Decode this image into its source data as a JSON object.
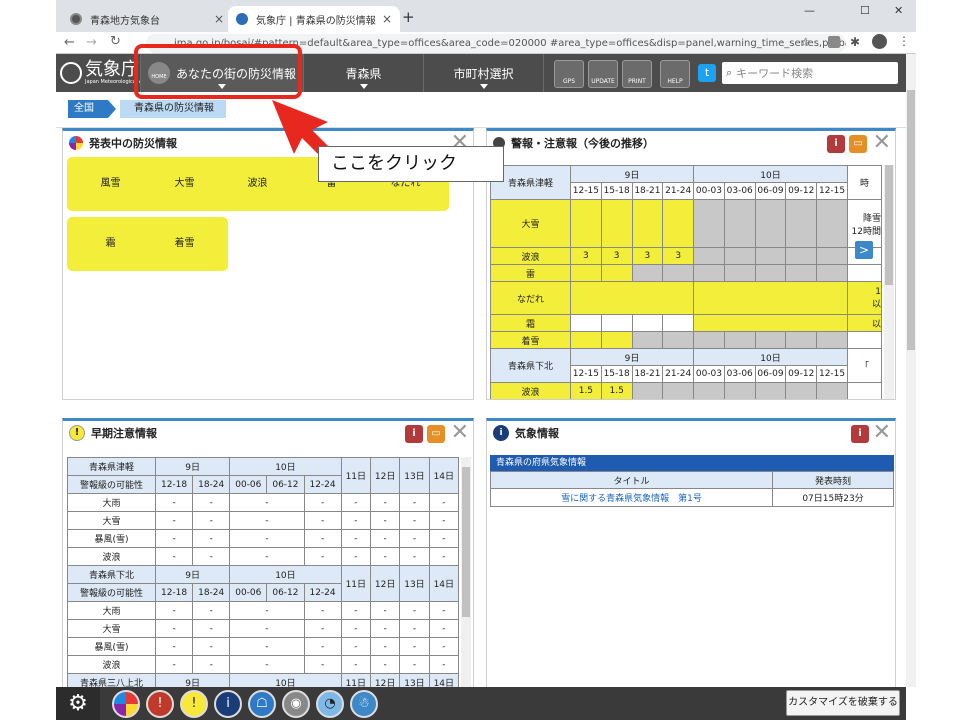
{
  "browser": {
    "tabs": [
      {
        "title": "青森地方気象台",
        "close": "×"
      },
      {
        "title": "気象庁 | 青森県の防災情報",
        "close": "×"
      }
    ],
    "new_tab": "+",
    "window_controls": {
      "minimize": "—",
      "maximize": "☐",
      "close": "✕"
    },
    "url": "jma.go.jp/bosai/#pattern=default&area_type=offices&area_code=020000  #area_type=offices&disp=panel,warning_time_series,probability,information,forecaster_comment,radar,amedas!temp,snow&area_type=offices&a..."
  },
  "site": {
    "logo_main": "気象庁",
    "logo_sub": "Japan Meteorological Agency",
    "nav": {
      "home_label": "HOME",
      "bosai": "あなたの街の防災情報",
      "pref": "青森県",
      "city": "市町村選択"
    },
    "icons": {
      "gps": "GPS",
      "update": "UPDATE",
      "print": "PRINT",
      "help": "HELP"
    },
    "search_placeholder": "キーワード検索"
  },
  "breadcrumb": {
    "home": "全国",
    "current": "青森県の防災情報"
  },
  "callout": {
    "text": "ここをクリック",
    "color": "#e8281e"
  },
  "panel_warnings": {
    "title": "発表中の防災情報",
    "items": [
      "風雪",
      "大雪",
      "波浪",
      "雷",
      "なだれ",
      "霜",
      "着雪"
    ]
  },
  "panel_timeseries": {
    "title": "警報・注意報（今後の推移）",
    "area1": "青森県津軽",
    "area2": "青森県下北",
    "day9": "9日",
    "day10": "10日",
    "hours": [
      "12-15",
      "15-18",
      "18-21",
      "21-24",
      "00-03",
      "03-06",
      "06-09",
      "09-12",
      "12-15"
    ],
    "rows": [
      "大雪",
      "波浪",
      "雷",
      "なだれ",
      "霜",
      "着雪"
    ],
    "wave_values": [
      "3",
      "3",
      "3",
      "3"
    ],
    "wave2_values": [
      "1.5",
      "1.5"
    ],
    "right_snow": "降雪",
    "right_snow2": "12時間",
    "right_avalanche": "以",
    "right_frost": "以",
    "right_trunc": "時",
    "right_trunc2": "1",
    "right_trunc3": "「",
    "next_arrow": ">"
  },
  "panel_early": {
    "title": "早期注意情報",
    "areas": [
      "青森県津軽",
      "青森県下北",
      "青森県三八上北"
    ],
    "day9": "9日",
    "day10": "10日",
    "day11": "11日",
    "day12": "12日",
    "day13": "13日",
    "day14": "14日",
    "possibility": "警報級の可能性",
    "hours": [
      "12-18",
      "18-24",
      "00-06",
      "06-12",
      "12-24"
    ],
    "rows": [
      "大雨",
      "大雪",
      "暴風(雪)",
      "波浪"
    ],
    "dash": "-"
  },
  "panel_weather": {
    "title": "気象情報",
    "table_header": "青森県の府県気象情報",
    "col_title": "タイトル",
    "col_time": "発表時刻",
    "row_title": "雪に関する青森県気象情報　第1号",
    "row_time": "07日15時23分"
  },
  "bottom": {
    "settings": "⚙",
    "customize": "カスタマイズを破棄する"
  }
}
